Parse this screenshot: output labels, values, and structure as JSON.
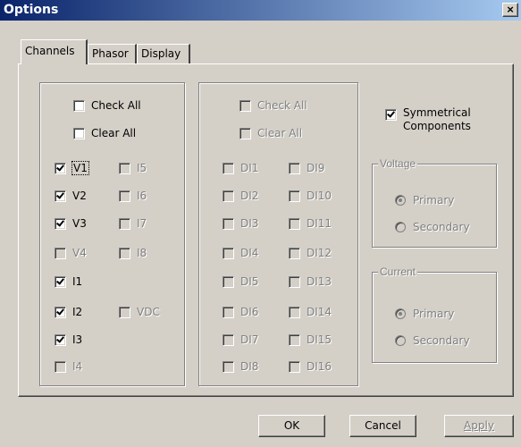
{
  "window": {
    "title": "Options",
    "close_glyph": "×"
  },
  "tabs": [
    {
      "label": "Channels",
      "active": true
    },
    {
      "label": "Phasor",
      "active": false
    },
    {
      "label": "Display",
      "active": false
    }
  ],
  "analog_group": {
    "check_all": {
      "label": "Check All",
      "checked": false
    },
    "clear_all": {
      "label": "Clear All",
      "checked": false
    },
    "channels": {
      "V1": {
        "label": "V1",
        "checked": true,
        "enabled": true
      },
      "V2": {
        "label": "V2",
        "checked": true,
        "enabled": true
      },
      "V3": {
        "label": "V3",
        "checked": true,
        "enabled": true
      },
      "V4": {
        "label": "V4",
        "checked": false,
        "enabled": false
      },
      "I1": {
        "label": "I1",
        "checked": true,
        "enabled": true
      },
      "I2": {
        "label": "I2",
        "checked": true,
        "enabled": true
      },
      "I3": {
        "label": "I3",
        "checked": true,
        "enabled": true
      },
      "I4": {
        "label": "I4",
        "checked": false,
        "enabled": false
      },
      "I5": {
        "label": "I5",
        "checked": false,
        "enabled": false
      },
      "I6": {
        "label": "I6",
        "checked": false,
        "enabled": false
      },
      "I7": {
        "label": "I7",
        "checked": false,
        "enabled": false
      },
      "I8": {
        "label": "I8",
        "checked": false,
        "enabled": false
      },
      "VDC": {
        "label": "VDC",
        "checked": false,
        "enabled": false
      }
    }
  },
  "digital_group": {
    "check_all": {
      "label": "Check All",
      "enabled": false
    },
    "clear_all": {
      "label": "Clear All",
      "enabled": false
    },
    "channels": [
      "DI1",
      "DI2",
      "DI3",
      "DI4",
      "DI5",
      "DI6",
      "DI7",
      "DI8",
      "DI9",
      "DI10",
      "DI11",
      "DI12",
      "DI13",
      "DI14",
      "DI15",
      "DI16"
    ]
  },
  "symmetrical": {
    "line1": "Symmetrical",
    "line2": "Components",
    "checked": true
  },
  "voltage_group": {
    "title": "Voltage",
    "primary": "Primary",
    "secondary": "Secondary",
    "selected": "Primary"
  },
  "current_group": {
    "title": "Current",
    "primary": "Primary",
    "secondary": "Secondary",
    "selected": "Primary"
  },
  "buttons": {
    "ok": "OK",
    "cancel": "Cancel",
    "apply": "Apply"
  },
  "icons": {
    "checkbox": "checkbox-icon",
    "radio": "radio-icon",
    "close": "close-icon"
  }
}
